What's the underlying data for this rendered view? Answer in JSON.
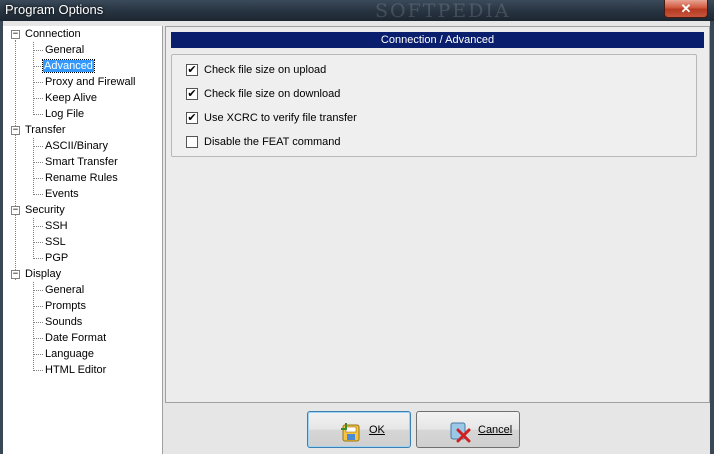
{
  "window": {
    "title": "Program Options",
    "close_label": "✕",
    "watermark": "SOFTPEDIA"
  },
  "tree": {
    "groups": [
      {
        "label": "Connection",
        "expander": "−",
        "children": [
          "General",
          "Advanced",
          "Proxy and Firewall",
          "Keep Alive",
          "Log File"
        ]
      },
      {
        "label": "Transfer",
        "expander": "−",
        "children": [
          "ASCII/Binary",
          "Smart Transfer",
          "Rename Rules",
          "Events"
        ]
      },
      {
        "label": "Security",
        "expander": "−",
        "children": [
          "SSH",
          "SSL",
          "PGP"
        ]
      },
      {
        "label": "Display",
        "expander": "−",
        "children": [
          "General",
          "Prompts",
          "Sounds",
          "Date Format",
          "Language",
          "HTML Editor"
        ]
      }
    ],
    "selected": "Connection / Advanced"
  },
  "panel": {
    "header": "Connection / Advanced",
    "options": [
      {
        "label": "Check file size on upload",
        "checked": true,
        "mark": "✔"
      },
      {
        "label": "Check file size on download",
        "checked": true,
        "mark": "✔"
      },
      {
        "label": "Use XCRC to verify file transfer",
        "checked": true,
        "mark": "✔"
      },
      {
        "label": "Disable the FEAT command",
        "checked": false,
        "mark": ""
      }
    ]
  },
  "buttons": {
    "ok_label": "OK",
    "cancel_label": "Cancel"
  }
}
